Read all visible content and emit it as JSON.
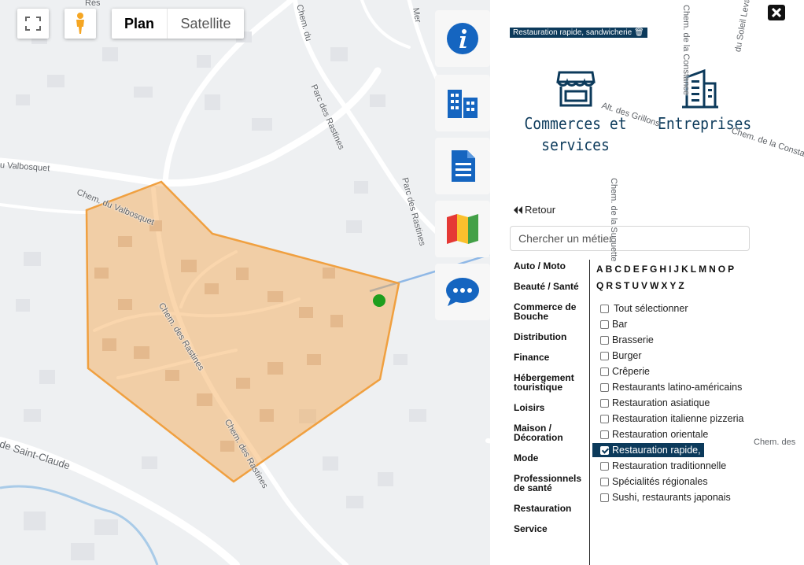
{
  "map": {
    "type_buttons": [
      "Plan",
      "Satellite"
    ],
    "labels": [
      "Rés",
      "Chem. du",
      "Mer",
      "Parc des Rastines",
      "Parc des Rastines",
      "u Valbosquet",
      "Chem. du Valbosquet",
      "Chem. des Rastines",
      "Chem. des Rastines",
      "de Saint-Claude",
      "Alt. des Grillons",
      "Chem. de la Constance",
      "Chem. de la Suquette",
      "du Soleil Levant",
      "Chem. de la Constance",
      "Chem. des"
    ],
    "zone_color": "#f5a54a",
    "marker_color": "#1e9e1e"
  },
  "tools": [
    "info-icon",
    "buildings-icon",
    "document-icon",
    "map-icon",
    "chat-icon"
  ],
  "panel": {
    "tag": "Restauration rapide, sandwicherie 🗑",
    "categories": [
      {
        "label_line1": "Commerces et",
        "label_line2": "services",
        "icon": "storefront-icon"
      },
      {
        "label_line1": "Entreprises",
        "label_line2": "",
        "icon": "office-building-icon"
      }
    ],
    "back_label": "Retour",
    "search_placeholder": "Chercher un métier",
    "sectors": [
      {
        "l1": "Auto / Moto",
        "l2": ""
      },
      {
        "l1": "Beauté / Santé",
        "l2": ""
      },
      {
        "l1": "Commerce de",
        "l2": "Bouche"
      },
      {
        "l1": "Distribution",
        "l2": ""
      },
      {
        "l1": "Finance",
        "l2": ""
      },
      {
        "l1": "Hébergement",
        "l2": "touristique"
      },
      {
        "l1": "Loisirs",
        "l2": ""
      },
      {
        "l1": "Maison /",
        "l2": "Décoration"
      },
      {
        "l1": "Mode",
        "l2": ""
      },
      {
        "l1": "Professionnels",
        "l2": "de santé"
      },
      {
        "l1": "Restauration",
        "l2": ""
      },
      {
        "l1": "Service",
        "l2": ""
      }
    ],
    "letters": [
      "A",
      "B",
      "C",
      "D",
      "E",
      "F",
      "G",
      "H",
      "I",
      "J",
      "K",
      "L",
      "M",
      "N",
      "O",
      "P",
      "Q",
      "R",
      "S",
      "T",
      "U",
      "V",
      "W",
      "X",
      "Y",
      "Z"
    ],
    "items": [
      {
        "label": "Tout sélectionner",
        "checked": false
      },
      {
        "label": "Bar",
        "checked": false
      },
      {
        "label": "Brasserie",
        "checked": false
      },
      {
        "label": "Burger",
        "checked": false
      },
      {
        "label": "Crêperie",
        "checked": false
      },
      {
        "label": "Restaurants latino-américains",
        "checked": false
      },
      {
        "label": "Restauration asiatique",
        "checked": false
      },
      {
        "label": "Restauration italienne pizzeria",
        "checked": false
      },
      {
        "label": "Restauration orientale",
        "checked": false
      },
      {
        "label": "Restauration rapide,",
        "checked": true
      },
      {
        "label": "Restauration traditionnelle",
        "checked": false
      },
      {
        "label": "Spécialités régionales",
        "checked": false
      },
      {
        "label": "Sushi, restaurants japonais",
        "checked": false
      }
    ],
    "accent": "#0c3a5b",
    "tool_blue": "#1565c0"
  }
}
